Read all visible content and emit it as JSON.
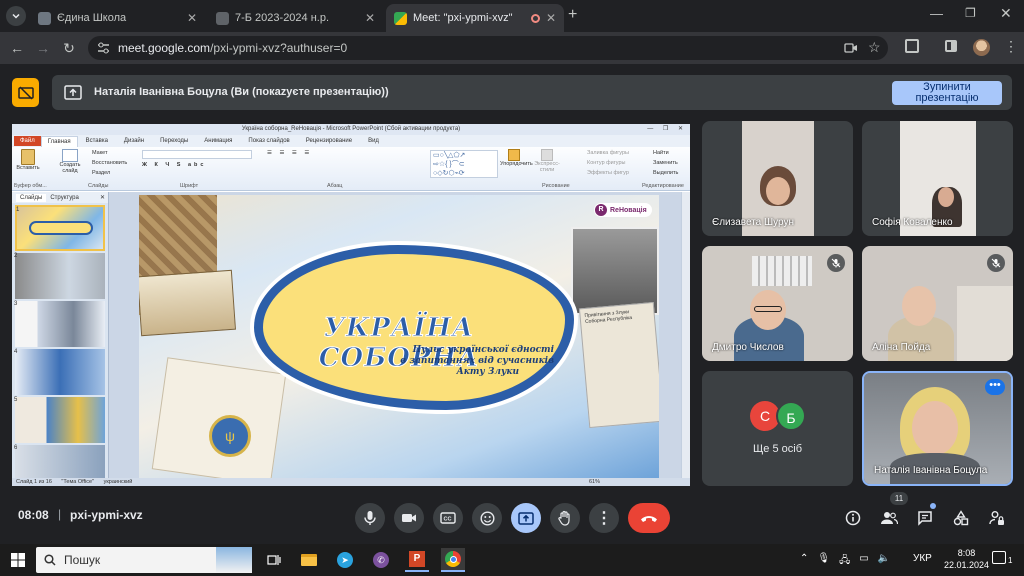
{
  "browser": {
    "tabs": [
      {
        "title": "Єдина Школа",
        "color": "#6e7781"
      },
      {
        "title": "7-Б 2023-2024 н.р.",
        "color": "#5f6368"
      },
      {
        "title": "Meet: \"pxi-ypmi-xvz\"",
        "color": "#34a853"
      }
    ],
    "url_host": "meet.google.com",
    "url_path": "/pxi-ypmi-xvz?authuser=0"
  },
  "presenting": {
    "text": "Наталія Іванівна Боцула (Ви (покazуєте презентацію))",
    "stop_label": "Зупинити презентацію"
  },
  "powerpoint": {
    "title": "Україна соборна_ReНовація - Microsoft PowerPoint (Сбой активации продукта)",
    "tabs": [
      "Файл",
      "Главная",
      "Вставка",
      "Дизайн",
      "Переходы",
      "Анимация",
      "Показ слайдов",
      "Рецензирование",
      "Вид"
    ],
    "groups": [
      "Буфер обм...",
      "Слайды",
      "Шрифт",
      "Абзац",
      "Рисование",
      "Редактирование"
    ],
    "buttons": {
      "paste": "Вставить",
      "new_slide": "Создать слайд",
      "layout": "Макет",
      "reset": "Восстановить",
      "section": "Раздел",
      "arrange": "Упорядочить",
      "quick_styles": "Экспресс-стили",
      "find": "Найти",
      "replace": "Заменить",
      "select": "Выделить",
      "fill": "Заливка фигуры",
      "outline": "Контур фигуры",
      "effects": "Эффекты фигур"
    },
    "pane_tabs": [
      "Слайды",
      "Структура"
    ],
    "slide_numbers": [
      "1",
      "2",
      "3",
      "4",
      "5",
      "6"
    ],
    "status": {
      "slide": "Слайд 1 из 16",
      "theme": "\"Тема Office\"",
      "lang": "украинский",
      "zoom": "61%"
    },
    "slide": {
      "brand": "ReНовація",
      "title": "УКРАЇНА СОБОРНА",
      "subtitle1": "Пульс української єдності",
      "subtitle2": "в запитаннях від сучасників",
      "subtitle3": "Акту Злуки",
      "doc_text": "Привітання з Злуки Соборна Республіка"
    }
  },
  "participants": [
    {
      "name": "Єлизавета Шурун",
      "muted": false,
      "bg": "#d8d2cc"
    },
    {
      "name": "Софія Коваленко",
      "muted": false,
      "bg": "#e9e6e2"
    },
    {
      "name": "Дмитро Числов",
      "muted": true,
      "bg": "#cfcac4"
    },
    {
      "name": "Аліна Пойда",
      "muted": true,
      "bg": "#cdc8c3"
    },
    {
      "name": "Наталія Іванівна Боцула",
      "muted": false,
      "bg": "#9aa0a6"
    }
  ],
  "others": {
    "label": "Ще 5 осіб",
    "avatars": [
      {
        "letter": "С",
        "color": "#e8453c"
      },
      {
        "letter": "Б",
        "color": "#34a853"
      }
    ]
  },
  "meeting": {
    "time": "08:08",
    "code": "pxi-ypmi-xvz",
    "people_count": "11"
  },
  "taskbar": {
    "search": "Пошук",
    "lang": "УКР",
    "time": "8:08",
    "date": "22.01.2024",
    "notif": "1"
  },
  "colors": {
    "accent": "#a8c7fa",
    "end_call": "#ea4335",
    "present_active": "#a8c7fa"
  }
}
